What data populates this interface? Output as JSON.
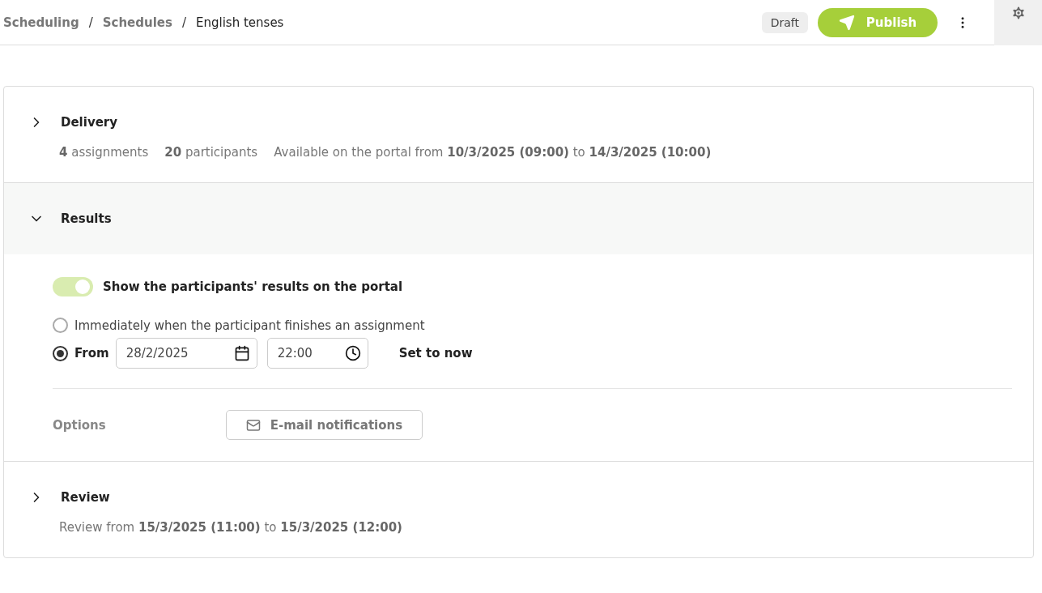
{
  "breadcrumb": [
    {
      "label": "Scheduling",
      "current": false
    },
    {
      "label": "Schedules",
      "current": false
    },
    {
      "label": "English tenses",
      "current": true
    }
  ],
  "separator": "/",
  "status_badge": "Draft",
  "publish_button": "Publish",
  "sections": [
    {
      "title": "Delivery",
      "expanded": false,
      "summary": [
        "**4** assignments",
        "**20** participants",
        "Available on the portal from **10/3/2025 (09:00)** to **14/3/2025 (10:00)**"
      ]
    },
    {
      "title": "Results",
      "expanded": true,
      "toggle": {
        "label": "Show the participants' results on the portal",
        "on": true
      },
      "options": [
        {
          "kind": "plain",
          "label": "Immediately when the participant finishes an assignment",
          "selected": false
        },
        {
          "kind": "datetime",
          "label": "From",
          "selected": true,
          "date": "28/2/2025",
          "time": "22:00",
          "action": "Set to now"
        }
      ],
      "options_label": "Options",
      "options_button": "E-mail notifications"
    },
    {
      "title": "Review",
      "expanded": false,
      "summary": [
        "Review from **15/3/2025 (11:00)** to **15/3/2025 (12:00)**"
      ]
    }
  ]
}
